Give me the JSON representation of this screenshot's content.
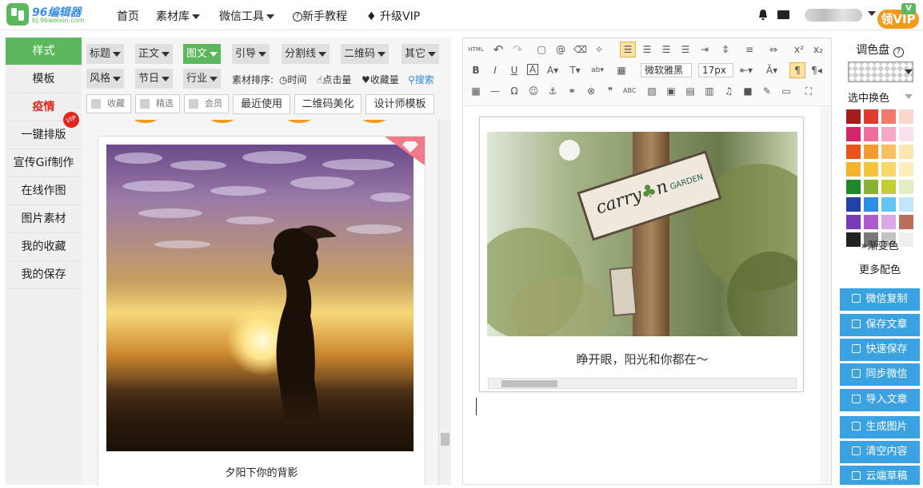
{
  "logo": {
    "title": "96编辑器",
    "subtitle": "bj.96weixin.com"
  },
  "nav": {
    "home": "首页",
    "materials": "素材库",
    "wechat_tools": "微信工具",
    "tutorial": "新手教程",
    "upgrade": "升级VIP"
  },
  "header": {
    "vip_badge": "领VIP"
  },
  "sidebar": {
    "items": [
      {
        "label": "样式"
      },
      {
        "label": "模板"
      },
      {
        "label": "疫情"
      },
      {
        "label": "一键排版"
      },
      {
        "label": "宣传Gif制作"
      },
      {
        "label": "在线作图"
      },
      {
        "label": "图片素材"
      },
      {
        "label": "我的收藏"
      },
      {
        "label": "我的保存"
      }
    ],
    "vip_tag": "VIP"
  },
  "filters": {
    "row1": [
      "标题",
      "正文",
      "图文",
      "引导",
      "分割线",
      "二维码",
      "其它"
    ],
    "row2": [
      "风格",
      "节日",
      "行业"
    ],
    "sort_label": "素材排序:",
    "sort_options": [
      "时间",
      "点击量",
      "收藏量"
    ],
    "search": "搜索",
    "checkboxes": [
      "收藏",
      "精选",
      "会员"
    ],
    "buttons": [
      "最近使用",
      "二维码美化",
      "设计师模板"
    ]
  },
  "material_card": {
    "caption": "夕阳下你的背影"
  },
  "editor": {
    "font_family": "微软雅黑",
    "font_size": "17px",
    "caption": "睁开眼，阳光和你都在～",
    "html_label": "HTML",
    "sign_text": "carry",
    "sign_text2": "n",
    "sign_sub": "GARDEN"
  },
  "palette": {
    "title": "调色盘",
    "subtitle": "选中换色",
    "gradient": "渐变色",
    "more": "更多配色",
    "colors": [
      [
        "#a61c1c",
        "#e03a2f",
        "#f07a6a",
        "#fbd7d0"
      ],
      [
        "#d4266a",
        "#ef6c9b",
        "#f6a9c4",
        "#fbe1ec"
      ],
      [
        "#e8541c",
        "#f59a2c",
        "#f7c064",
        "#fce6b0"
      ],
      [
        "#f5b32c",
        "#f7c43e",
        "#f7d768",
        "#fdeec0"
      ],
      [
        "#1e8a2a",
        "#8ab234",
        "#c4cd34",
        "#e4eec4"
      ],
      [
        "#2342a8",
        "#2a8ee8",
        "#64c4f4",
        "#bfe6fa"
      ],
      [
        "#7a3ab8",
        "#b05ad2",
        "#d8a8e8",
        "#b8705a"
      ],
      [
        "#222222",
        "#777777",
        "#c4c4c4",
        "#f0f0f0"
      ]
    ]
  },
  "actions": [
    "微信复制",
    "保存文章",
    "快速保存",
    "同步微信",
    "导入文章",
    "生成图片",
    "清空内容",
    "云端草稿"
  ]
}
